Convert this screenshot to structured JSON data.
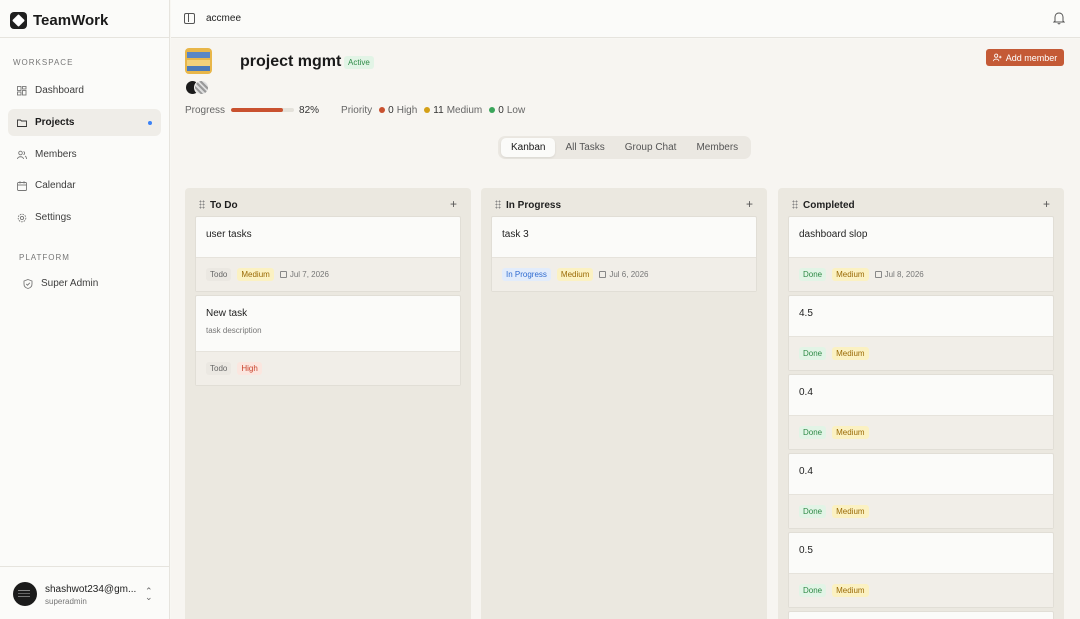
{
  "app": {
    "name": "TeamWork"
  },
  "sidebar": {
    "workspace_label": "WORKSPACE",
    "items": [
      {
        "label": "Dashboard",
        "icon": "grid-icon"
      },
      {
        "label": "Projects",
        "icon": "folder-icon",
        "active": true
      },
      {
        "label": "Members",
        "icon": "users-icon"
      },
      {
        "label": "Calendar",
        "icon": "calendar-icon"
      },
      {
        "label": "Settings",
        "icon": "gear-icon"
      }
    ],
    "platform_label": "PLATFORM",
    "platform_items": [
      {
        "label": "Super Admin",
        "icon": "shield-icon"
      }
    ],
    "user": {
      "name": "shashwot234@gm...",
      "role": "superadmin"
    }
  },
  "topbar": {
    "breadcrumb": "accmee"
  },
  "project": {
    "title": "project mgmt",
    "status": "Active",
    "add_member_label": "Add member",
    "progress_label": "Progress",
    "progress_value": 0.82,
    "progress_text": "82%",
    "priority_label": "Priority",
    "priorities": [
      {
        "count": "0",
        "label": "High",
        "color": "#c9512f"
      },
      {
        "count": "11",
        "label": "Medium",
        "color": "#d4a017"
      },
      {
        "count": "0",
        "label": "Low",
        "color": "#3aa55a"
      }
    ]
  },
  "tabs": [
    "Kanban",
    "All Tasks",
    "Group Chat",
    "Members"
  ],
  "columns": [
    {
      "title": "To Do",
      "cards": [
        {
          "title": "user tasks",
          "status": "Todo",
          "priority": "Medium",
          "date": "Jul 7, 2026"
        },
        {
          "title": "New task",
          "description": "task description",
          "status": "Todo",
          "priority": "High"
        }
      ]
    },
    {
      "title": "In Progress",
      "cards": [
        {
          "title": "task 3",
          "status": "In Progress",
          "priority": "Medium",
          "date": "Jul 6, 2026"
        }
      ]
    },
    {
      "title": "Completed",
      "cards": [
        {
          "title": "dashboard slop",
          "status": "Done",
          "priority": "Medium",
          "date": "Jul 8, 2026"
        },
        {
          "title": "4.5",
          "status": "Done",
          "priority": "Medium"
        },
        {
          "title": "0.4",
          "status": "Done",
          "priority": "Medium"
        },
        {
          "title": "0.4",
          "status": "Done",
          "priority": "Medium"
        },
        {
          "title": "0.5",
          "status": "Done",
          "priority": "Medium"
        }
      ]
    }
  ]
}
